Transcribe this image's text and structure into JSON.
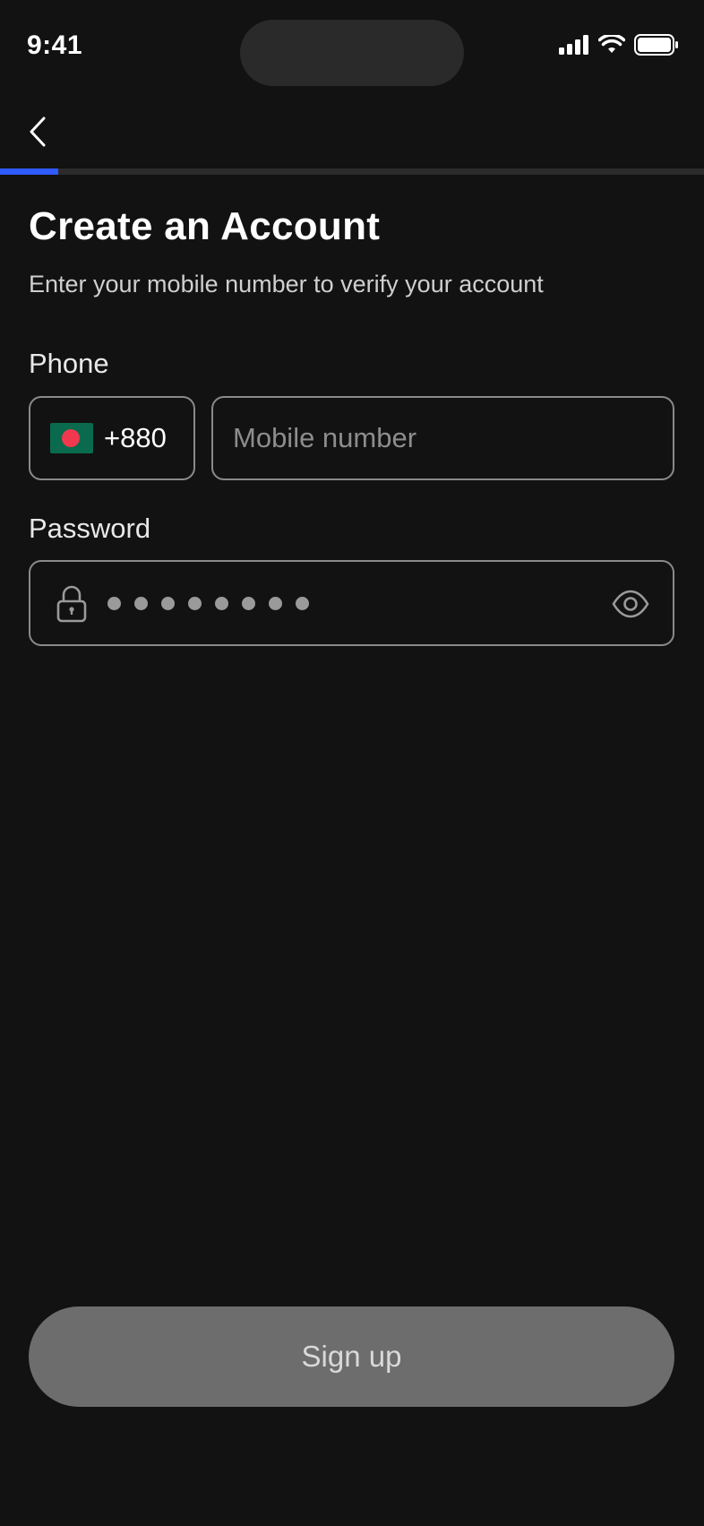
{
  "status_bar": {
    "time": "9:41"
  },
  "header": {
    "back_icon": "chevron-left-icon"
  },
  "progress": {
    "fraction": 0.083,
    "color": "#2f5bff"
  },
  "form": {
    "title": "Create an Account",
    "subtitle": "Enter your mobile number to verify your account",
    "phone": {
      "label": "Phone",
      "country_code": "+880",
      "country_flag": "bangladesh-flag-icon",
      "mobile_placeholder": "Mobile number",
      "mobile_value": ""
    },
    "password": {
      "label": "Password",
      "masked_value": "••••••••",
      "dot_count": 8,
      "lock_icon": "lock-icon",
      "visibility_icon": "eye-icon"
    }
  },
  "actions": {
    "signup_label": "Sign up"
  },
  "colors": {
    "background": "#121212",
    "accent": "#2f5bff",
    "button_disabled": "#6d6d6d"
  }
}
